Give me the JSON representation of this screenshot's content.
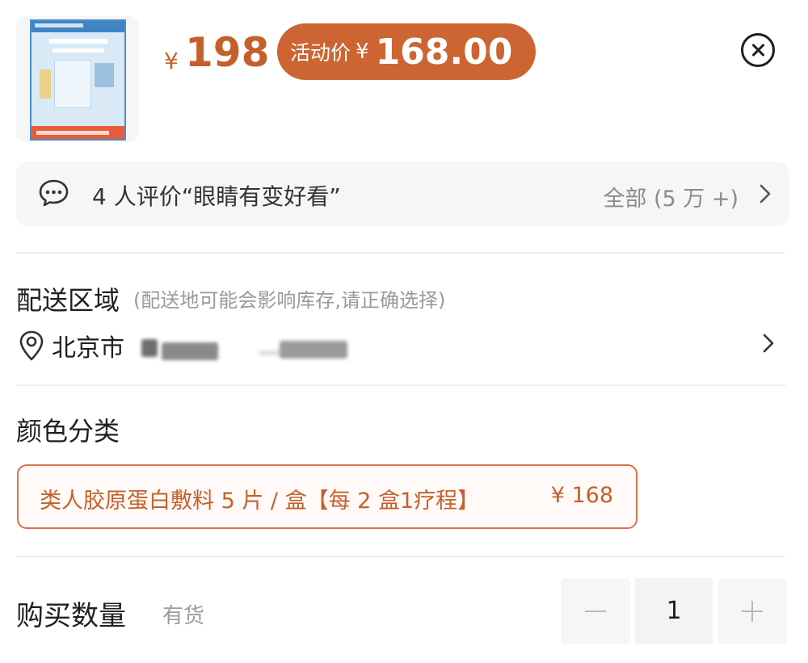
{
  "product": {
    "thumbnail_icon": "product-thumbnail",
    "price_currency": "¥",
    "price": "198",
    "promo_label": "活动价",
    "promo_currency": "¥",
    "promo_price": "168.00",
    "accent_color": "#cc6532"
  },
  "close": {
    "icon": "close-circle-icon"
  },
  "reviews": {
    "icon": "chat-bubble-icon",
    "summary": "4 人评价“眼睛有变好看”",
    "all_label": "全部 (5 万 +)",
    "chevron_icon": "chevron-right-icon"
  },
  "delivery": {
    "title": "配送区域",
    "note": "(配送地可能会影响库存,请正确选择)",
    "location_icon": "location-pin-icon",
    "city": "北京市",
    "chevron_icon": "chevron-right-icon"
  },
  "color": {
    "title": "颜色分类",
    "options": [
      {
        "name": "类人胶原蛋白敷料 5 片 / 盒【每 2 盒1疗程】",
        "price": "¥ 168",
        "selected": true
      }
    ]
  },
  "quantity": {
    "title": "购买数量",
    "stock": "有货",
    "value": "1",
    "minus_icon": "minus-icon",
    "plus_icon": "plus-icon"
  }
}
